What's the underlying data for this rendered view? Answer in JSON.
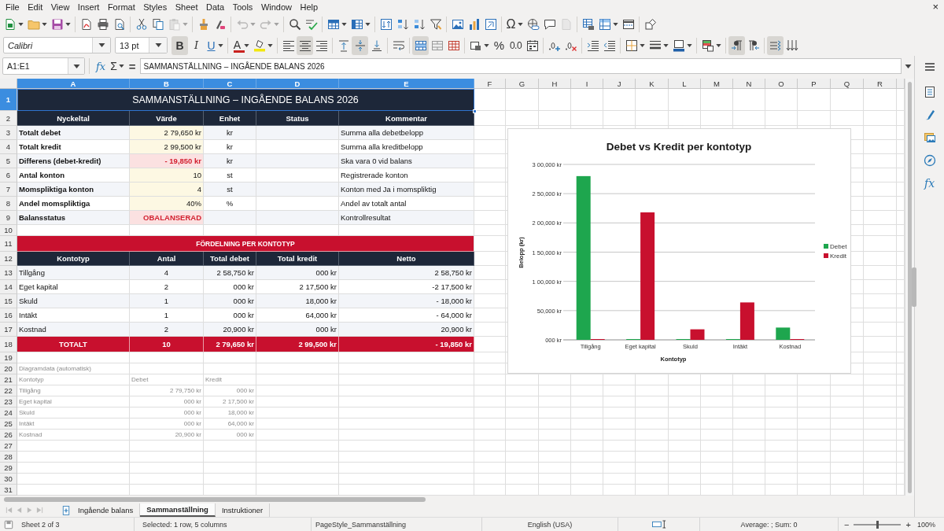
{
  "menu_bar": {
    "items": [
      "File",
      "Edit",
      "View",
      "Insert",
      "Format",
      "Styles",
      "Sheet",
      "Data",
      "Tools",
      "Window",
      "Help"
    ],
    "close": "×"
  },
  "standard_toolbar": {
    "groups": [
      [
        {
          "kind": "new",
          "dropdown": true,
          "disabled": false
        },
        {
          "kind": "open",
          "dropdown": true,
          "disabled": false
        },
        {
          "kind": "save",
          "dropdown": true,
          "disabled": false
        }
      ],
      [
        {
          "kind": "export-pdf",
          "disabled": false
        },
        {
          "kind": "print",
          "disabled": false
        },
        {
          "kind": "print-preview",
          "disabled": false
        }
      ],
      [
        {
          "kind": "cut",
          "disabled": false
        },
        {
          "kind": "copy",
          "disabled": false
        },
        {
          "kind": "paste",
          "dropdown": true,
          "disabled": true
        }
      ],
      [
        {
          "kind": "clone-formatting",
          "disabled": false
        },
        {
          "kind": "clear-formatting",
          "disabled": false
        }
      ],
      [
        {
          "kind": "undo",
          "dropdown": true,
          "disabled": true
        },
        {
          "kind": "redo",
          "dropdown": true,
          "disabled": true
        }
      ],
      [
        {
          "kind": "find-replace",
          "disabled": false
        },
        {
          "kind": "spelling",
          "disabled": false
        }
      ],
      [
        {
          "kind": "row",
          "dropdown": true,
          "disabled": false
        },
        {
          "kind": "column",
          "dropdown": true,
          "disabled": false
        }
      ],
      [
        {
          "kind": "sort",
          "disabled": false
        },
        {
          "kind": "sort-ascending",
          "disabled": false
        },
        {
          "kind": "sort-descending",
          "disabled": false
        },
        {
          "kind": "autofilter",
          "disabled": false
        }
      ],
      [
        {
          "kind": "image",
          "disabled": false
        },
        {
          "kind": "chart",
          "disabled": false
        },
        {
          "kind": "pivot-table",
          "disabled": false
        }
      ],
      [
        {
          "kind": "special-character",
          "label": "Ω",
          "dropdown": true,
          "disabled": false
        },
        {
          "kind": "hyperlink",
          "disabled": false
        },
        {
          "kind": "comment",
          "disabled": false
        },
        {
          "kind": "header-footer",
          "disabled": true
        }
      ],
      [
        {
          "kind": "print-area",
          "disabled": false
        },
        {
          "kind": "freeze",
          "dropdown": true,
          "disabled": false
        },
        {
          "kind": "split-window",
          "disabled": false
        }
      ],
      [
        {
          "kind": "draw-functions",
          "disabled": false
        }
      ]
    ]
  },
  "formatting_toolbar": {
    "font_name": "Calibri",
    "font_size": "13 pt",
    "groups": [
      [
        {
          "kind": "bold",
          "label": "B",
          "on": true
        },
        {
          "kind": "italic",
          "label": "I",
          "on": false
        },
        {
          "kind": "underline",
          "label": "U",
          "dropdown": true,
          "on": false
        }
      ],
      [
        {
          "kind": "font-color",
          "label": "A",
          "dropdown": true,
          "on": false
        },
        {
          "kind": "highlight",
          "dropdown": true,
          "on": false
        }
      ],
      [
        {
          "kind": "align-left",
          "on": false
        },
        {
          "kind": "align-center",
          "on": true
        },
        {
          "kind": "align-right",
          "on": false
        }
      ],
      [
        {
          "kind": "align-top",
          "on": false
        },
        {
          "kind": "align-middle",
          "on": true
        },
        {
          "kind": "align-bottom",
          "on": false
        }
      ],
      [
        {
          "kind": "wrap-text",
          "on": false
        }
      ],
      [
        {
          "kind": "merge-center",
          "on": true
        },
        {
          "kind": "merge",
          "on": false
        },
        {
          "kind": "unmerge",
          "on": false
        }
      ],
      [
        {
          "kind": "number-format",
          "dropdown": true,
          "on": false
        },
        {
          "kind": "percent",
          "label": "%",
          "on": false
        },
        {
          "kind": "number",
          "label": "0.0",
          "on": false
        },
        {
          "kind": "date",
          "on": false
        }
      ],
      [
        {
          "kind": "add-decimal",
          "on": false
        },
        {
          "kind": "delete-decimal",
          "on": false
        }
      ],
      [
        {
          "kind": "indent-increase",
          "on": false
        },
        {
          "kind": "indent-decrease",
          "on": false
        }
      ],
      [
        {
          "kind": "borders",
          "dropdown": true,
          "on": false
        },
        {
          "kind": "border-style",
          "dropdown": true,
          "on": false
        },
        {
          "kind": "border-color",
          "dropdown": true,
          "on": false
        }
      ],
      [
        {
          "kind": "conditional",
          "dropdown": true,
          "on": false
        }
      ],
      [
        {
          "kind": "left-to-right",
          "on": true
        },
        {
          "kind": "right-to-left",
          "on": false
        }
      ],
      [
        {
          "kind": "text-flow",
          "on": true
        },
        {
          "kind": "vertical-text",
          "on": false
        }
      ]
    ]
  },
  "formula_bar": {
    "name_box": "A1:E1",
    "function_wizard": "fx",
    "sum": "Σ",
    "equals": "=",
    "content": "SAMMANSTÄLLNING – INGÅENDE BALANS 2026"
  },
  "sidebar": {
    "buttons": [
      {
        "kind": "menu"
      },
      {
        "kind": "properties"
      },
      {
        "kind": "styles"
      },
      {
        "kind": "gallery"
      },
      {
        "kind": "navigator"
      },
      {
        "kind": "functions",
        "label": "fx"
      }
    ]
  },
  "sheet": {
    "column_headers": [
      {
        "label": "A",
        "selected": true
      },
      {
        "label": "B",
        "selected": true
      },
      {
        "label": "C",
        "selected": true
      },
      {
        "label": "D",
        "selected": true
      },
      {
        "label": "E",
        "selected": true
      },
      {
        "label": "F",
        "selected": false
      },
      {
        "label": "G",
        "selected": false
      },
      {
        "label": "H",
        "selected": false
      },
      {
        "label": "I",
        "selected": false
      },
      {
        "label": "J",
        "selected": false
      },
      {
        "label": "K",
        "selected": false
      },
      {
        "label": "L",
        "selected": false
      },
      {
        "label": "M",
        "selected": false
      },
      {
        "label": "N",
        "selected": false
      },
      {
        "label": "O",
        "selected": false
      },
      {
        "label": "P",
        "selected": false
      },
      {
        "label": "Q",
        "selected": false
      },
      {
        "label": "R",
        "selected": false
      }
    ],
    "row_headers": [
      {
        "label": "1",
        "selected": true
      },
      {
        "label": "2",
        "selected": false
      },
      {
        "label": "3",
        "selected": false
      },
      {
        "label": "4",
        "selected": false
      },
      {
        "label": "5",
        "selected": false
      },
      {
        "label": "6",
        "selected": false
      },
      {
        "label": "7",
        "selected": false
      },
      {
        "label": "8",
        "selected": false
      },
      {
        "label": "9",
        "selected": false
      },
      {
        "label": "10",
        "selected": false
      },
      {
        "label": "11",
        "selected": false
      },
      {
        "label": "12",
        "selected": false
      },
      {
        "label": "13",
        "selected": false
      },
      {
        "label": "14",
        "selected": false
      },
      {
        "label": "15",
        "selected": false
      },
      {
        "label": "16",
        "selected": false
      },
      {
        "label": "17",
        "selected": false
      },
      {
        "label": "18",
        "selected": false
      },
      {
        "label": "19",
        "selected": false
      },
      {
        "label": "20",
        "selected": false
      },
      {
        "label": "21",
        "selected": false
      },
      {
        "label": "22",
        "selected": false
      },
      {
        "label": "23",
        "selected": false
      },
      {
        "label": "24",
        "selected": false
      },
      {
        "label": "25",
        "selected": false
      },
      {
        "label": "26",
        "selected": false
      },
      {
        "label": "27",
        "selected": false
      },
      {
        "label": "28",
        "selected": false
      },
      {
        "label": "29",
        "selected": false
      },
      {
        "label": "30",
        "selected": false
      },
      {
        "label": "31",
        "selected": false
      }
    ],
    "title": {
      "text": "SAMMANSTÄLLNING – INGÅENDE BALANS 2026"
    },
    "key_figures": {
      "header": [
        "Nyckeltal",
        "Värde",
        "Enhet",
        "Status",
        "Kommentar"
      ],
      "rows": [
        {
          "label": "Totalt debet",
          "value": "2 79,650 kr",
          "unit": "kr",
          "comment": "Summa alla debetbelopp",
          "alert": false
        },
        {
          "label": "Totalt kredit",
          "value": "2 99,500 kr",
          "unit": "kr",
          "comment": "Summa alla kreditbelopp",
          "alert": false
        },
        {
          "label": "Differens (debet-kredit)",
          "value": "- 19,850 kr",
          "unit": "kr",
          "comment": "Ska vara 0 vid balans",
          "alert": true
        },
        {
          "label": "Antal konton",
          "value": "10",
          "unit": "st",
          "comment": "Registrerade konton",
          "alert": false
        },
        {
          "label": "Momspliktiga konton",
          "value": "4",
          "unit": "st",
          "comment": "Konton med Ja i momspliktig",
          "alert": false
        },
        {
          "label": "Andel momspliktiga",
          "value": "40%",
          "unit": "%",
          "comment": "Andel av totalt antal",
          "alert": false
        },
        {
          "label": "Balansstatus",
          "value": "OBALANSERAD",
          "comment": "Kontrollresultat",
          "alert": true
        }
      ]
    },
    "distribution": {
      "title": "FÖRDELNING PER KONTOTYP",
      "header": [
        "Kontotyp",
        "Antal",
        "Total debet",
        "Total kredit",
        "Netto"
      ],
      "rows": [
        [
          "Tillgång",
          "4",
          "2 58,750 kr",
          "000 kr",
          "2 58,750 kr"
        ],
        [
          "Eget kapital",
          "2",
          "000 kr",
          "2 17,500 kr",
          "-2 17,500 kr"
        ],
        [
          "Skuld",
          "1",
          "000 kr",
          "18,000 kr",
          "- 18,000 kr"
        ],
        [
          "Intäkt",
          "1",
          "000 kr",
          "64,000 kr",
          "- 64,000 kr"
        ],
        [
          "Kostnad",
          "2",
          "20,900 kr",
          "000 kr",
          "20,900 kr"
        ]
      ],
      "total": [
        "TOTALT",
        "10",
        "2 79,650 kr",
        "2 99,500 kr",
        "- 19,850 kr"
      ]
    },
    "chart_source": {
      "title": "Diagramdata (automatisk)",
      "header": [
        "Kontotyp",
        "Debet",
        "Kredit"
      ],
      "rows": [
        [
          "Tillgång",
          "2 79,750 kr",
          "000 kr"
        ],
        [
          "Eget kapital",
          "000 kr",
          "2 17,500 kr"
        ],
        [
          "Skuld",
          "000 kr",
          "18,000 kr"
        ],
        [
          "Intäkt",
          "000 kr",
          "64,000 kr"
        ],
        [
          "Kostnad",
          "20,900 kr",
          "000 kr"
        ]
      ]
    },
    "chart": {
      "chart_data": {
        "type": "bar",
        "title": "Debet vs Kredit per kontotyp",
        "xlabel": "Kontotyp",
        "ylabel": "Belopp (kr)",
        "categories": [
          "Tillgång",
          "Eget kapital",
          "Skuld",
          "Intäkt",
          "Kostnad"
        ],
        "series": [
          {
            "name": "Debet",
            "color": "#1ea64e",
            "values": [
              280000,
              0,
              0,
              0,
              21000
            ]
          },
          {
            "name": "Kredit",
            "color": "#c8102e",
            "values": [
              0,
              218000,
              18000,
              64000,
              0
            ]
          }
        ],
        "ylim": [
          0,
          300000
        ],
        "yticks": [
          {
            "value": 0,
            "label": "000 kr"
          },
          {
            "value": 50000,
            "label": "50,000 kr"
          },
          {
            "value": 100000,
            "label": "1 00,000 kr"
          },
          {
            "value": 150000,
            "label": "1 50,000 kr"
          },
          {
            "value": 200000,
            "label": "2 00,000 kr"
          },
          {
            "value": 250000,
            "label": "2 50,000 kr"
          },
          {
            "value": 300000,
            "label": "3 00,000 kr"
          }
        ],
        "grid": true,
        "legend": "right"
      }
    }
  },
  "sheet_tabs": {
    "navigation": [
      {
        "kind": "first",
        "disabled": true
      },
      {
        "kind": "previous",
        "disabled": true
      },
      {
        "kind": "next",
        "disabled": true
      },
      {
        "kind": "last",
        "disabled": true
      }
    ],
    "tabs": [
      {
        "label": "Ingående balans",
        "selected": false
      },
      {
        "label": "Sammanställning",
        "selected": true
      },
      {
        "label": "Instruktioner",
        "selected": false
      }
    ]
  },
  "status_bar": {
    "sheet": "Sheet 2 of 3",
    "selection": "Selected: 1 row, 5 columns",
    "page_style": "PageStyle_Sammanställning",
    "language": "English (USA)",
    "sum": "Average: ; Sum: 0",
    "zoom": {
      "minus": "−",
      "plus": "+",
      "level": 0.5,
      "reading": "100%"
    }
  }
}
